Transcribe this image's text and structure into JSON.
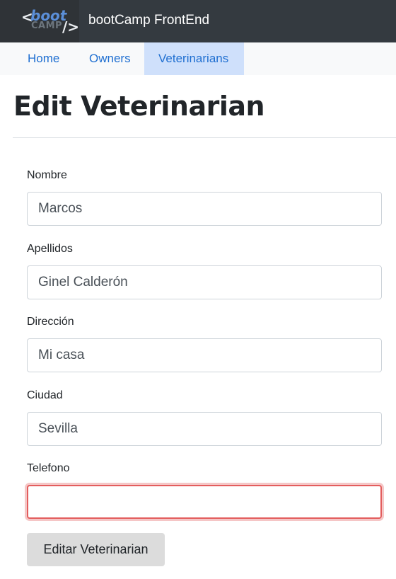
{
  "header": {
    "logo": {
      "boot": "boot",
      "camp": "CAMP",
      "open": "<",
      "close": "/>"
    },
    "brand": "bootCamp FrontEnd"
  },
  "nav": {
    "items": [
      {
        "label": "Home"
      },
      {
        "label": "Owners"
      },
      {
        "label": "Veterinarians",
        "active": true
      }
    ]
  },
  "page": {
    "title": "Edit Veterinarian"
  },
  "form": {
    "fields": [
      {
        "label": "Nombre",
        "value": "Marcos"
      },
      {
        "label": "Apellidos",
        "value": "Ginel Calderón"
      },
      {
        "label": "Dirección",
        "value": "Mi casa"
      },
      {
        "label": "Ciudad",
        "value": "Sevilla"
      },
      {
        "label": "Telefono",
        "value": "",
        "invalid": true
      }
    ],
    "submit_label": "Editar Veterinarian"
  },
  "colors": {
    "header_bg": "#343a40",
    "nav_bg": "#f8f9fa",
    "nav_active_bg": "#cfe0fb",
    "link": "#1f6fd1",
    "invalid_border": "#e35d5d",
    "button_bg": "#dcdcdc"
  }
}
